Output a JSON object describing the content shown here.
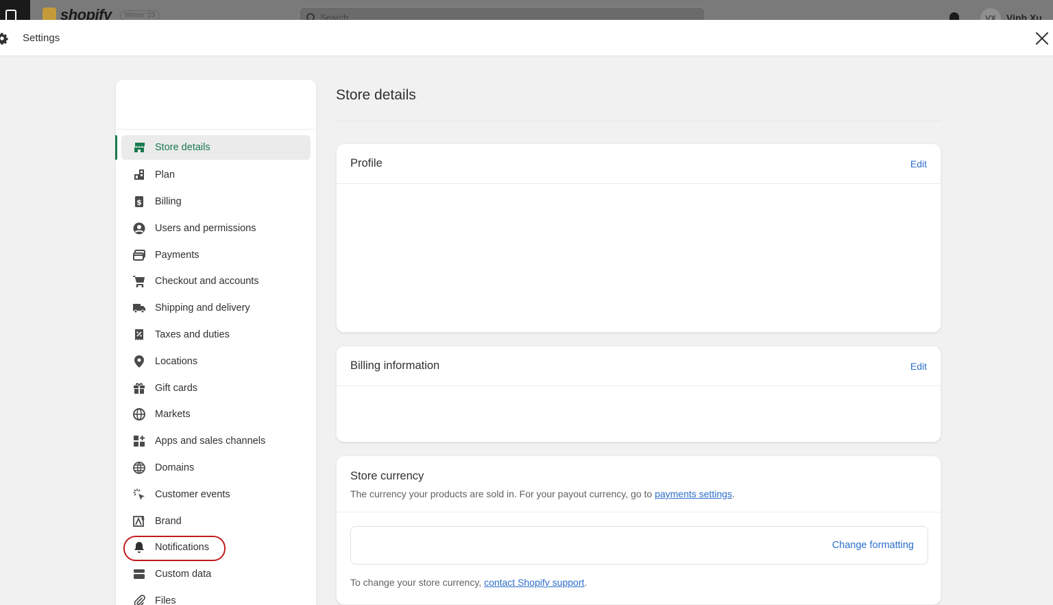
{
  "topbar": {
    "brand_name": "shopify",
    "brand_tag": "Winter '23",
    "search_placeholder": "Search",
    "avatar_initials": "VX",
    "user_name": "Vinh Xu"
  },
  "header": {
    "title": "Settings"
  },
  "sidebar": {
    "items": [
      {
        "label": "Store details",
        "icon": "store-icon"
      },
      {
        "label": "Plan",
        "icon": "plan-icon"
      },
      {
        "label": "Billing",
        "icon": "billing-icon"
      },
      {
        "label": "Users and permissions",
        "icon": "user-icon"
      },
      {
        "label": "Payments",
        "icon": "payments-icon"
      },
      {
        "label": "Checkout and accounts",
        "icon": "cart-icon"
      },
      {
        "label": "Shipping and delivery",
        "icon": "truck-icon"
      },
      {
        "label": "Taxes and duties",
        "icon": "tax-icon"
      },
      {
        "label": "Locations",
        "icon": "location-pin-icon"
      },
      {
        "label": "Gift cards",
        "icon": "gift-icon"
      },
      {
        "label": "Markets",
        "icon": "globe-icon"
      },
      {
        "label": "Apps and sales channels",
        "icon": "apps-icon"
      },
      {
        "label": "Domains",
        "icon": "domains-globe-icon"
      },
      {
        "label": "Customer events",
        "icon": "cursor-click-icon"
      },
      {
        "label": "Brand",
        "icon": "brand-icon"
      },
      {
        "label": "Notifications",
        "icon": "bell-icon"
      },
      {
        "label": "Custom data",
        "icon": "custom-data-icon"
      },
      {
        "label": "Files",
        "icon": "paperclip-icon"
      }
    ]
  },
  "main": {
    "page_title": "Store details",
    "profile": {
      "title": "Profile",
      "edit_label": "Edit"
    },
    "billing": {
      "title": "Billing information",
      "edit_label": "Edit"
    },
    "currency": {
      "title": "Store currency",
      "desc_prefix": "The currency your products are sold in. For your payout currency, go to ",
      "desc_link": "payments settings",
      "desc_suffix": ".",
      "change_formatting": "Change formatting",
      "foot_prefix": "To change your store currency, ",
      "foot_link": "contact Shopify support",
      "foot_suffix": "."
    }
  },
  "colors": {
    "accent_green": "#1a7a4f",
    "link_blue": "#2c6ecb",
    "highlight_red": "#c01a1a"
  }
}
